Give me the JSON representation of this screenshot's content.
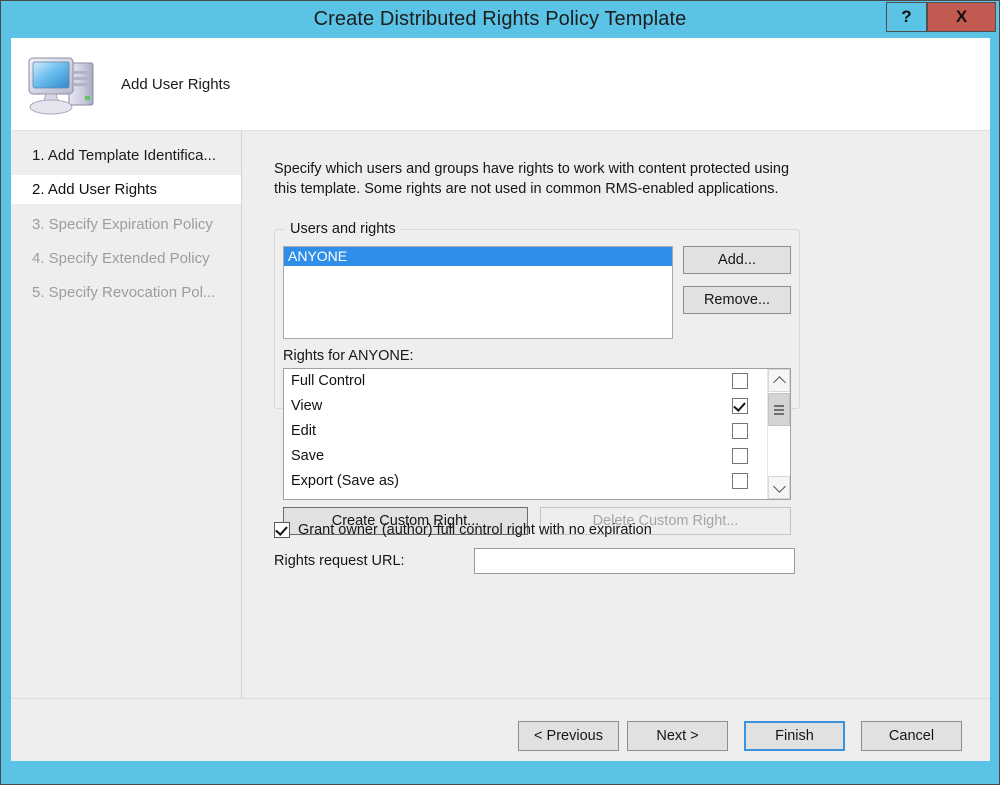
{
  "window": {
    "title": "Create Distributed Rights Policy Template",
    "help_button": "?",
    "close_button": "X",
    "accent_color": "#5bc3e5",
    "close_color": "#c35a52"
  },
  "header": {
    "title": "Add User Rights",
    "icon": "computer-icon"
  },
  "sidebar": {
    "items": [
      {
        "label": "1. Add Template Identifica...",
        "state": "completed"
      },
      {
        "label": "2. Add User Rights",
        "state": "selected"
      },
      {
        "label": "3. Specify Expiration Policy",
        "state": "disabled"
      },
      {
        "label": "4. Specify Extended Policy",
        "state": "disabled"
      },
      {
        "label": "5. Specify Revocation Pol...",
        "state": "disabled"
      }
    ]
  },
  "main": {
    "intro": "Specify which users and groups have rights to work with content protected using this template. Some rights are not used in common RMS-enabled applications.",
    "group_label": "Users and rights",
    "users": [
      {
        "name": "ANYONE",
        "selected": true
      }
    ],
    "add_button": "Add...",
    "remove_button": "Remove...",
    "rights_label": "Rights for ANYONE:",
    "rights": [
      {
        "label": "Full Control",
        "checked": false
      },
      {
        "label": "View",
        "checked": true
      },
      {
        "label": "Edit",
        "checked": false
      },
      {
        "label": "Save",
        "checked": false
      },
      {
        "label": "Export (Save as)",
        "checked": false
      }
    ],
    "create_custom_right_button": "Create Custom Right...",
    "delete_custom_right_button": "Delete Custom Right...",
    "delete_custom_right_enabled": false,
    "grant_owner_label": "Grant owner (author) full control right with no expiration",
    "grant_owner_checked": true,
    "url_label": "Rights request URL:",
    "url_value": "",
    "url_placeholder": "",
    "selection_color": "#2f8fe8"
  },
  "footer": {
    "previous_button": "< Previous",
    "next_button": "Next >",
    "finish_button": "Finish",
    "cancel_button": "Cancel",
    "focused_button": "Finish"
  }
}
